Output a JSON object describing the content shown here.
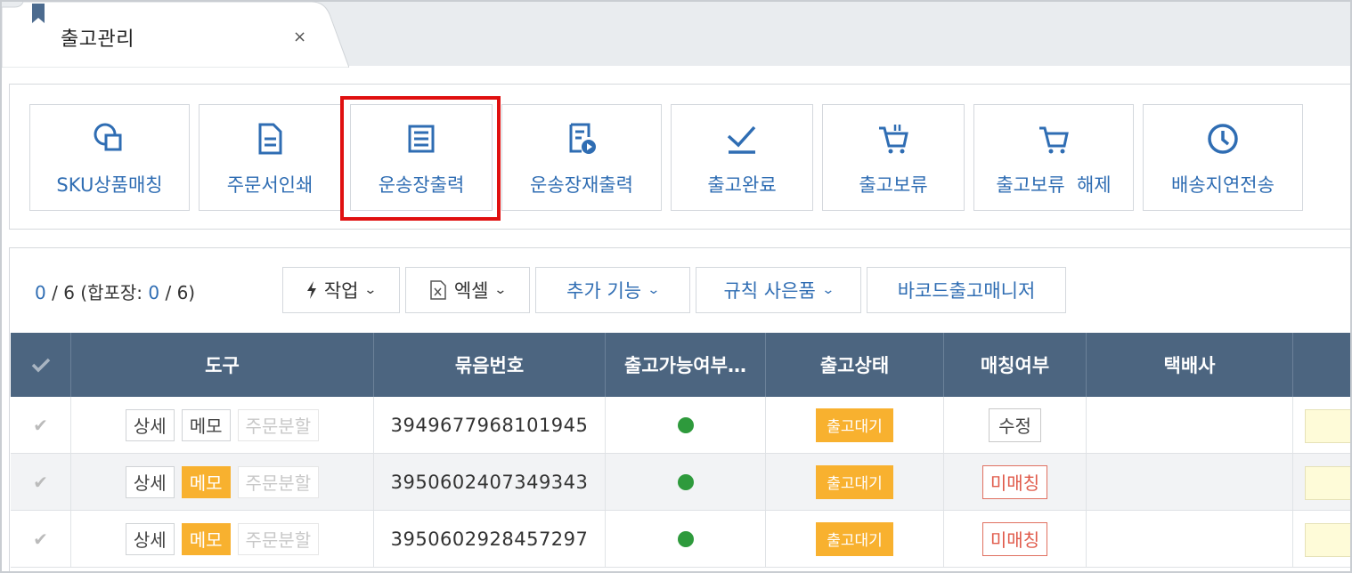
{
  "tab": {
    "title": "출고관리",
    "close_symbol": "×"
  },
  "toolbar": {
    "buttons": [
      {
        "label": "SKU상품매칭",
        "icon": "sku-match-icon"
      },
      {
        "label": "주문서인쇄",
        "icon": "document-icon"
      },
      {
        "label": "운송장출력",
        "icon": "waybill-icon"
      },
      {
        "label": "운송장재출력",
        "icon": "waybill-reprint-icon"
      },
      {
        "label": "출고완료",
        "icon": "check-icon"
      },
      {
        "label": "출고보류",
        "icon": "cart-hold-icon"
      },
      {
        "label": "출고보류  해제",
        "icon": "cart-release-icon"
      },
      {
        "label": "배송지연전송",
        "icon": "clock-icon"
      }
    ]
  },
  "counter": {
    "selected": "0",
    "slash1": " / ",
    "total": "6",
    "merge_prefix": " (합포장: ",
    "merge_selected": "0",
    "slash2": " / ",
    "merge_total": "6)"
  },
  "actions": {
    "work": "작업",
    "excel": "엑셀",
    "extra": "추가 기능",
    "rule": "규칙 사은품",
    "barcode": "바코드출고매니저"
  },
  "table": {
    "headers": [
      "도구",
      "묶음번호",
      "출고가능여부…",
      "출고상태",
      "매칭여부",
      "택배사"
    ],
    "tool_labels": {
      "detail": "상세",
      "memo": "메모",
      "split": "주문분할"
    },
    "rows": [
      {
        "bundle": "3949677968101945",
        "status": "출고대기",
        "match": "수정",
        "memo_active": false
      },
      {
        "bundle": "3950602407349343",
        "status": "출고대기",
        "match": "미매칭",
        "memo_active": true
      },
      {
        "bundle": "3950602928457297",
        "status": "출고대기",
        "match": "미매칭",
        "memo_active": true
      }
    ]
  },
  "colors": {
    "header_bg": "#4c6580",
    "accent_blue": "#2f6db3",
    "status_orange": "#f8b12f",
    "highlight_red": "#e01010",
    "available_green": "#2e9a3c"
  }
}
